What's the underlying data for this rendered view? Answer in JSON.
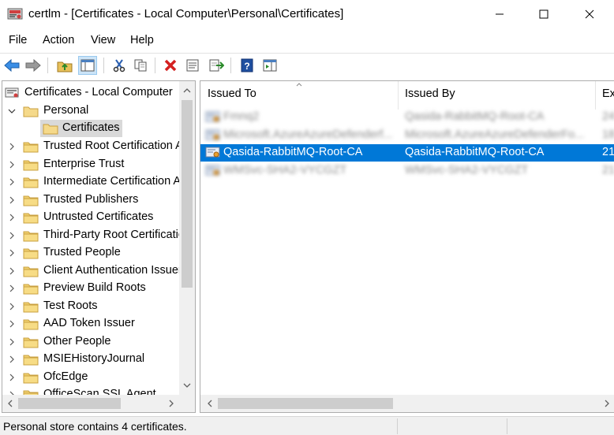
{
  "window": {
    "title": "certlm - [Certificates - Local Computer\\Personal\\Certificates]"
  },
  "menu": [
    "File",
    "Action",
    "View",
    "Help"
  ],
  "toolbar": [
    "back-icon",
    "forward-icon",
    "up-folder-icon",
    "show-hide-tree-icon",
    "cut-icon",
    "copy-icon",
    "delete-icon",
    "properties-icon",
    "export-list-icon",
    "help-icon",
    "show-action-pane-icon"
  ],
  "tree": {
    "root": "Certificates - Local Computer",
    "personal": "Personal",
    "certificates": "Certificates",
    "items": [
      "Trusted Root Certification Authorities",
      "Enterprise Trust",
      "Intermediate Certification Authorities",
      "Trusted Publishers",
      "Untrusted Certificates",
      "Third-Party Root Certification Authorities",
      "Trusted People",
      "Client Authentication Issuers",
      "Preview Build Roots",
      "Test Roots",
      "AAD Token Issuer",
      "Other People",
      "MSIEHistoryJournal",
      "OfcEdge",
      "OfficeScan SSL Agent"
    ]
  },
  "list": {
    "columns": [
      "Issued To",
      "Issued By",
      "Ex"
    ],
    "rows": [
      {
        "issued_to": "Fmnq2",
        "issued_by": "Qasida-RabbitMQ-Root-CA",
        "exp": "24"
      },
      {
        "issued_to": "Microsoft.AzureAzureDefenderf...",
        "issued_by": "Microsoft.AzureAzureDefenderFo...",
        "exp": "18"
      },
      {
        "issued_to": "Qasida-RabbitMQ-Root-CA",
        "issued_by": "Qasida-RabbitMQ-Root-CA",
        "exp": "21"
      },
      {
        "issued_to": "WMSvc-SHA2-VYCGZT",
        "issued_by": "WMSvc-SHA2-VYCGZT",
        "exp": "21"
      }
    ],
    "selected_index": 2
  },
  "status": {
    "text": "Personal store contains 4 certificates."
  },
  "colors": {
    "selection": "#0078d7",
    "tree_selection": "#d9d9d9",
    "folder": "#e8c05a"
  }
}
